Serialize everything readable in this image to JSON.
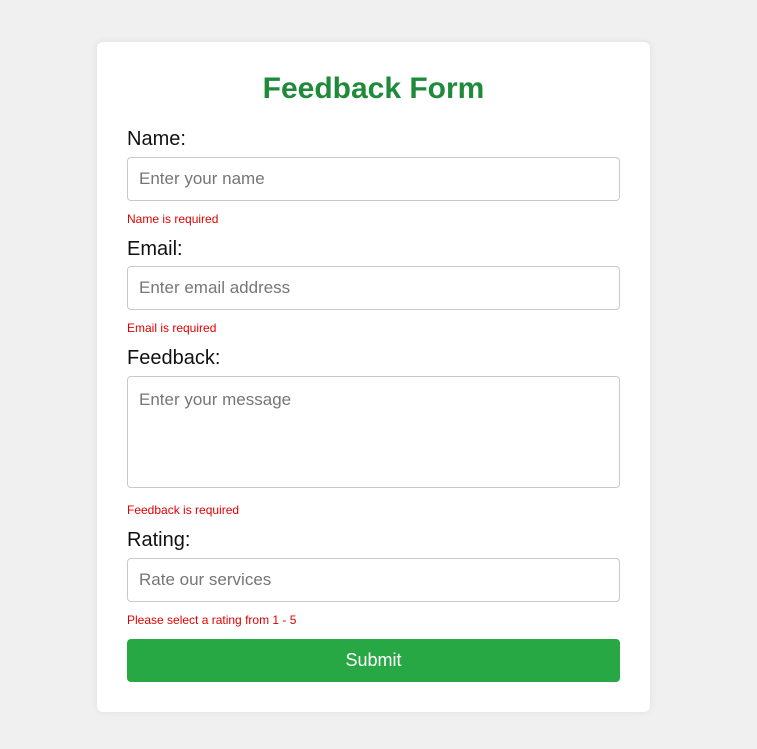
{
  "form": {
    "title": "Feedback Form",
    "name": {
      "label": "Name:",
      "placeholder": "Enter your name",
      "value": "",
      "error": "Name is required"
    },
    "email": {
      "label": "Email:",
      "placeholder": "Enter email address",
      "value": "",
      "error": "Email is required"
    },
    "feedback": {
      "label": "Feedback:",
      "placeholder": "Enter your message",
      "value": "",
      "error": "Feedback is required"
    },
    "rating": {
      "label": "Rating:",
      "placeholder": "Rate our services",
      "value": "",
      "error": "Please select a rating from 1 - 5"
    },
    "submit_label": "Submit"
  },
  "colors": {
    "title": "#1f8a3a",
    "submit_button": "#28a745",
    "error_text": "#e00000",
    "page_background": "#f0f0f0"
  }
}
